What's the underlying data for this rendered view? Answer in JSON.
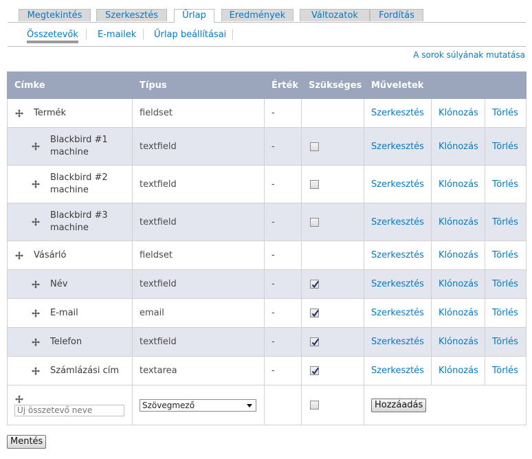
{
  "tabs": [
    {
      "label": "Megtekintés",
      "active": false
    },
    {
      "label": "Szerkesztés",
      "active": false
    },
    {
      "label": "Űrlap",
      "active": true
    },
    {
      "label": "Eredmények",
      "active": false
    },
    {
      "label": "Változatok",
      "active": false
    },
    {
      "label": "Fordítás",
      "active": false
    }
  ],
  "subtabs": [
    {
      "label": "Összetevők",
      "active": true
    },
    {
      "label": "E-mailek",
      "active": false
    },
    {
      "label": "Űrlap beállításai",
      "active": false
    }
  ],
  "weight_link": "A sorok súlyának mutatása",
  "table": {
    "headers": {
      "label": "Címke",
      "type": "Típus",
      "value": "Érték",
      "required": "Szükséges",
      "operations": "Műveletek"
    },
    "rows": [
      {
        "label": "Termék",
        "type": "fieldset",
        "value": "-",
        "required": null,
        "edit": "Szerkesztés",
        "clone": "Klónozás",
        "delete": "Törlés"
      },
      {
        "label": "Blackbird #1 machine",
        "type": "textfield",
        "value": "-",
        "required": false,
        "edit": "Szerkesztés",
        "clone": "Klónozás",
        "delete": "Törlés"
      },
      {
        "label": "Blackbird #2 machine",
        "type": "textfield",
        "value": "-",
        "required": false,
        "edit": "Szerkesztés",
        "clone": "Klónozás",
        "delete": "Törlés"
      },
      {
        "label": "Blackbird #3 machine",
        "type": "textfield",
        "value": "-",
        "required": false,
        "edit": "Szerkesztés",
        "clone": "Klónozás",
        "delete": "Törlés"
      },
      {
        "label": "Vásárló",
        "type": "fieldset",
        "value": "-",
        "required": null,
        "edit": "Szerkesztés",
        "clone": "Klónozás",
        "delete": "Törlés"
      },
      {
        "label": "Név",
        "type": "textfield",
        "value": "-",
        "required": true,
        "edit": "Szerkesztés",
        "clone": "Klónozás",
        "delete": "Törlés"
      },
      {
        "label": "E-mail",
        "type": "email",
        "value": "-",
        "required": true,
        "edit": "Szerkesztés",
        "clone": "Klónozás",
        "delete": "Törlés"
      },
      {
        "label": "Telefon",
        "type": "textfield",
        "value": "-",
        "required": true,
        "edit": "Szerkesztés",
        "clone": "Klónozás",
        "delete": "Törlés"
      },
      {
        "label": "Számlázási cím",
        "type": "textarea",
        "value": "-",
        "required": true,
        "edit": "Szerkesztés",
        "clone": "Klónozás",
        "delete": "Törlés"
      }
    ],
    "add_row": {
      "name_placeholder": "Új összetevő neve",
      "type_selected": "Szövegmező",
      "required": false,
      "add_button": "Hozzáadás"
    }
  },
  "save_button": "Mentés",
  "colors": {
    "link": "#027ac6",
    "header_bg": "#9ba6bd",
    "stripe_bg": "#e3e6ee"
  }
}
